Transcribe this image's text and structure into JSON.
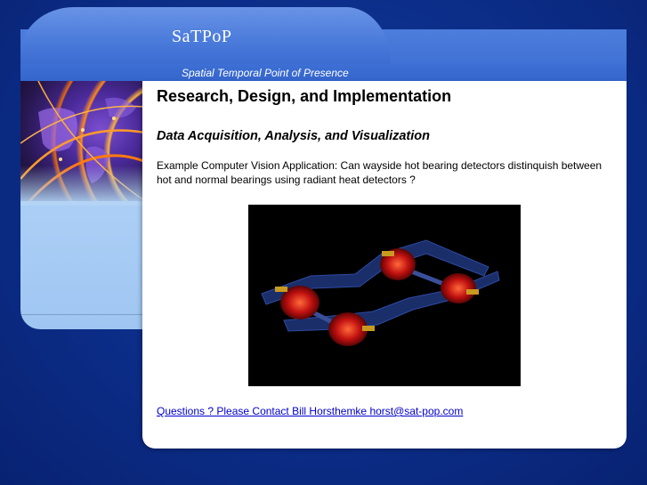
{
  "header": {
    "title": "SaTPoP",
    "tagline": "Spatial Temporal Point of Presence"
  },
  "main": {
    "heading": "Research, Design, and Implementation",
    "subheading": "Data Acquisition, Analysis, and Visualization",
    "paragraph": "Example Computer Vision Application: Can wayside hot bearing detectors distinquish between hot and normal bearings using radiant heat detectors ?",
    "contact_link": "Questions ? Please Contact Bill Horsthemke horst@sat-pop.com"
  },
  "images": {
    "left_banner": "globe-network-image",
    "figure": "railcar-truck-heat-visualization"
  },
  "colors": {
    "page_background": "#0a2a82",
    "header_blue": "#4677d9",
    "left_panel": "#b4d4f6",
    "link": "#0000cc"
  }
}
